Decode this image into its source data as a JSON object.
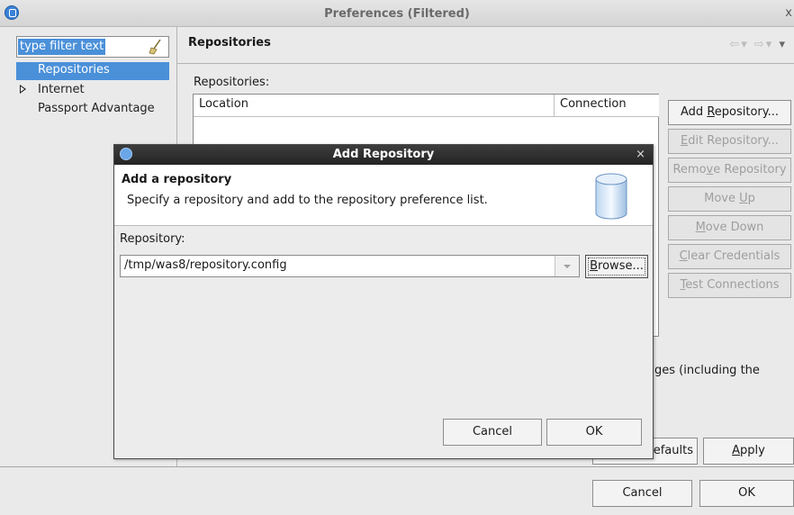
{
  "window": {
    "title": "Preferences (Filtered)",
    "close_glyph": "x"
  },
  "filter": {
    "placeholder": "type filter text"
  },
  "tree": {
    "items": [
      {
        "label": "Repositories",
        "selected": true
      },
      {
        "label": "Internet",
        "expandable": true
      },
      {
        "label": "Passport Advantage"
      }
    ]
  },
  "page": {
    "title": "Repositories",
    "section_label": "Repositories:",
    "columns": [
      "Location",
      "Connection"
    ],
    "description_fragment": "ges (including the",
    "nav_glyphs": {
      "back": "⇦",
      "forward": "⇨",
      "dropdown": "▾",
      "small_dd": "▾"
    }
  },
  "side_buttons": [
    {
      "pre": "Add ",
      "key": "R",
      "post": "epository...",
      "enabled": true
    },
    {
      "pre": "",
      "key": "E",
      "post": "dit Repository...",
      "enabled": false
    },
    {
      "pre": "Remo",
      "key": "v",
      "post": "e Repository",
      "enabled": false
    },
    {
      "pre": "Move ",
      "key": "U",
      "post": "p",
      "enabled": false
    },
    {
      "pre": "",
      "key": "M",
      "post": "ove Down",
      "enabled": false
    },
    {
      "pre": "",
      "key": "C",
      "post": "lear Credentials",
      "enabled": false
    },
    {
      "pre": "",
      "key": "T",
      "post": "est Connections",
      "enabled": false
    }
  ],
  "prefs_buttons": {
    "restore_fragment": "efaults",
    "apply": {
      "pre": "",
      "key": "A",
      "post": "pply"
    },
    "cancel": "Cancel",
    "ok": "OK"
  },
  "dialog": {
    "title": "Add Repository",
    "close_glyph": "×",
    "banner_title": "Add a repository",
    "banner_message": "Specify a repository and add to the repository preference list.",
    "field_label": "Repository:",
    "repository_value": "/tmp/was8/repository.config",
    "browse": {
      "pre": "",
      "key": "B",
      "post": "rowse..."
    },
    "cancel": "Cancel",
    "ok": "OK",
    "icon": "database-icon"
  },
  "colors": {
    "selection": "#4a90d9",
    "dialog_titlebar": "#2e2e2e"
  }
}
